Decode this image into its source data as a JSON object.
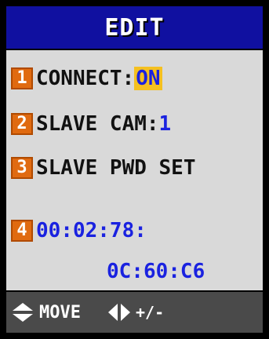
{
  "title": "EDIT",
  "menu": {
    "items": [
      {
        "num": "1",
        "label": "CONNECT:",
        "value": "ON",
        "selected": true
      },
      {
        "num": "2",
        "label": "SLAVE CAM:",
        "value": "1"
      },
      {
        "num": "3",
        "label": "SLAVE PWD SET"
      },
      {
        "num": "4",
        "value_line1": "00:02:78:",
        "value_line2": "0C:60:C6"
      }
    ]
  },
  "footer": {
    "move_label": "MOVE",
    "move_icon": "up-down-arrows-icon",
    "adjust_label": "+/-",
    "adjust_icon": "left-right-arrows-icon"
  },
  "colors": {
    "title_bg": "#1010a0",
    "content_bg": "#d9d9d9",
    "badge_bg": "#e06a10",
    "value_text": "#1a22e0",
    "selected_bg": "#f5c020",
    "footer_bg": "#4a4a4a"
  }
}
